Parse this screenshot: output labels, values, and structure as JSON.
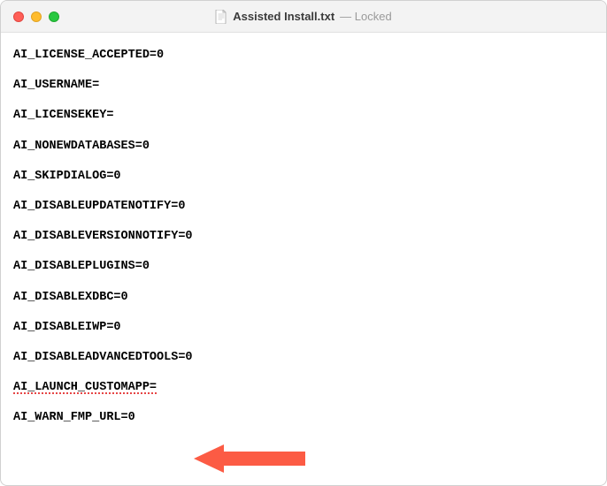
{
  "title": "Assisted Install.txt",
  "status": "Locked",
  "status_separator": " — ",
  "lines": [
    "AI_LICENSE_ACCEPTED=0",
    "AI_USERNAME=",
    "AI_LICENSEKEY=",
    "AI_NONEWDATABASES=0",
    "AI_SKIPDIALOG=0",
    "AI_DISABLEUPDATENOTIFY=0",
    "AI_DISABLEVERSIONNOTIFY=0",
    "AI_DISABLEPLUGINS=0",
    "AI_DISABLEXDBC=0",
    "AI_DISABLEIWP=0",
    "AI_DISABLEADVANCEDTOOLS=0",
    "AI_LAUNCH_CUSTOMAPP=",
    "AI_WARN_FMP_URL=0"
  ],
  "spellcheck_line_index": 11,
  "colors": {
    "arrow": "#fc5b44"
  }
}
